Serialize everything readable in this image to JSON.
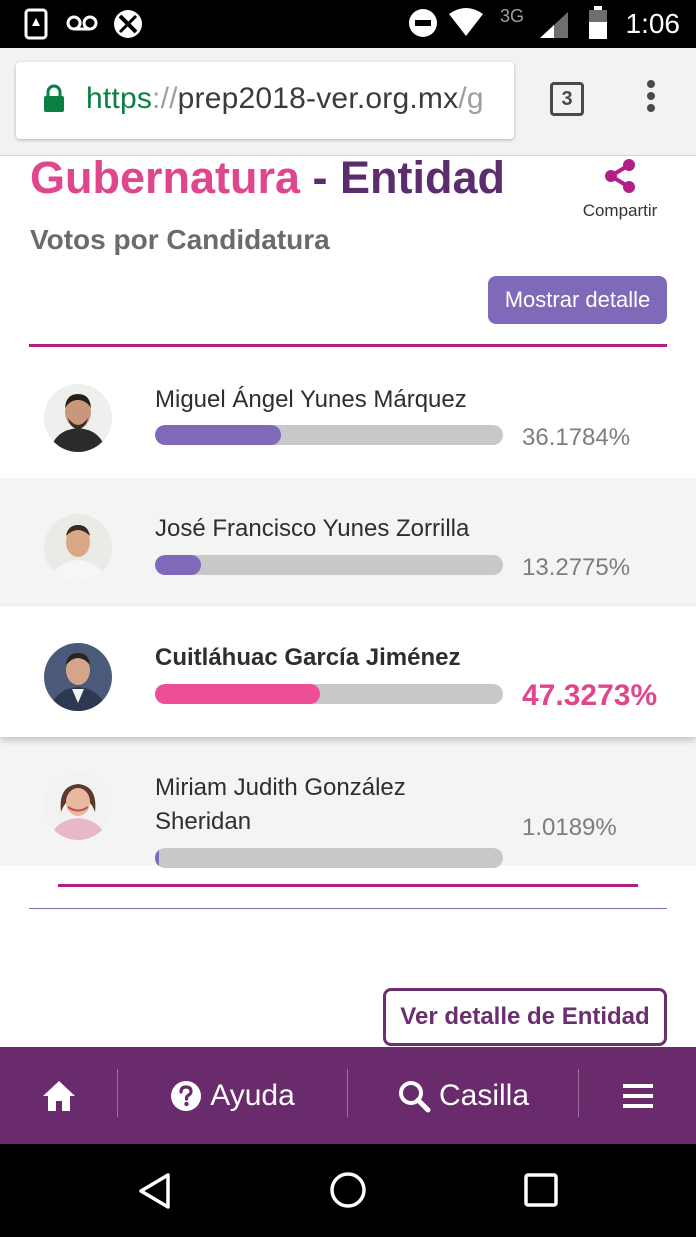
{
  "status_bar": {
    "network": "3G",
    "time": "1:06"
  },
  "browser": {
    "url_scheme": "https",
    "url_sep": "://",
    "url_host": "prep2018-ver.org.mx",
    "url_rest": "/g",
    "tab_count": "3"
  },
  "header": {
    "title_part1": "Gubernatura",
    "title_sep": " - ",
    "title_part2": "Entidad",
    "subtitle": "Votos por Candidatura",
    "share_label": "Compartir",
    "detail_button": "Mostrar detalle"
  },
  "candidates": [
    {
      "name": "Miguel Ángel Yunes Márquez",
      "percent": "36.1784%",
      "share": 0.361784,
      "bar_color": "#7e6ab8"
    },
    {
      "name": "José Francisco Yunes Zorrilla",
      "percent": "13.2775%",
      "share": 0.132775,
      "bar_color": "#7e6ab8"
    },
    {
      "name": "Cuitláhuac García Jiménez",
      "percent": "47.3273%",
      "share": 0.473273,
      "bar_color": "#ee4e96"
    },
    {
      "name_line1": "Miriam Judith González",
      "name_line2": "Sheridan",
      "percent": "1.0189%",
      "share": 0.010189,
      "bar_color": "#7e6ab8"
    }
  ],
  "entity_button": "Ver detalle de Entidad",
  "bottom_nav": {
    "help": "Ayuda",
    "casilla": "Casilla"
  },
  "colors": {
    "brand_purple": "#6a2b6c",
    "accent_pink": "#e0468e",
    "bar_purple": "#7e6ab8"
  }
}
